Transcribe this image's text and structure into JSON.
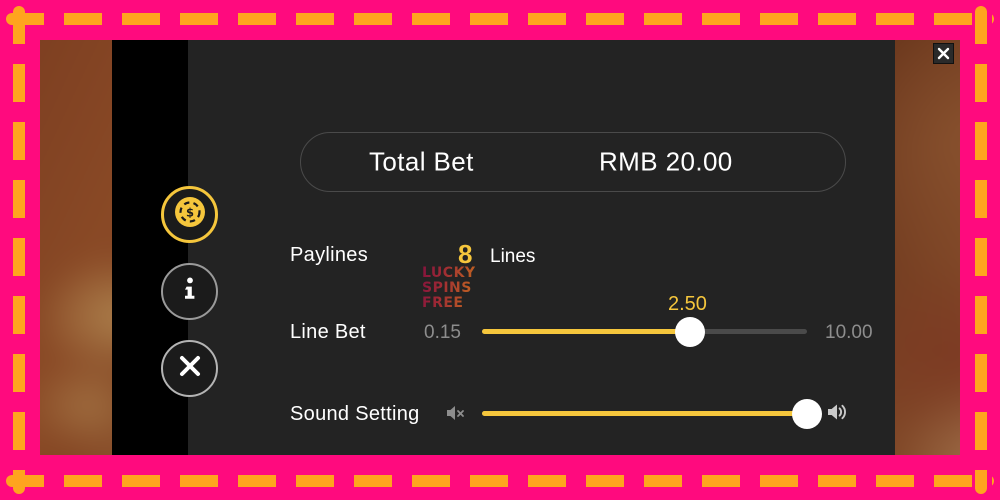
{
  "frame": {
    "pink_color": "#FF0A7E",
    "dash_color": "#FFA41E"
  },
  "theme": {
    "panel_bg": "#232323",
    "rail_bg": "#000000",
    "accent": "#F5C63C",
    "text": "#FFFFFF",
    "muted_text": "#8D8D8D",
    "track": "#4A4A4A"
  },
  "window": {
    "close_label": "✕",
    "close_icon": "close-icon"
  },
  "sidebar": {
    "items": [
      {
        "name": "bet-settings",
        "icon": "casino-chip-icon",
        "active": true
      },
      {
        "name": "game-info",
        "icon": "info-icon",
        "label": "i",
        "active": false
      },
      {
        "name": "close-dialog",
        "icon": "close-icon",
        "label": "✕",
        "active": false
      }
    ]
  },
  "total_bet": {
    "label": "Total Bet",
    "value": "RMB 20.00"
  },
  "paylines": {
    "label": "Paylines",
    "count": "8",
    "unit": "Lines"
  },
  "watermark": {
    "line1": "LUCKY",
    "line2": "SPINS",
    "line3": "FREE"
  },
  "line_bet": {
    "label": "Line Bet",
    "min": "0.15",
    "max": "10.00",
    "current": "2.50"
  },
  "sound": {
    "label": "Sound Setting",
    "mute_icon": "speaker-mute-icon",
    "on_icon": "speaker-on-icon",
    "level_percent": 96
  }
}
